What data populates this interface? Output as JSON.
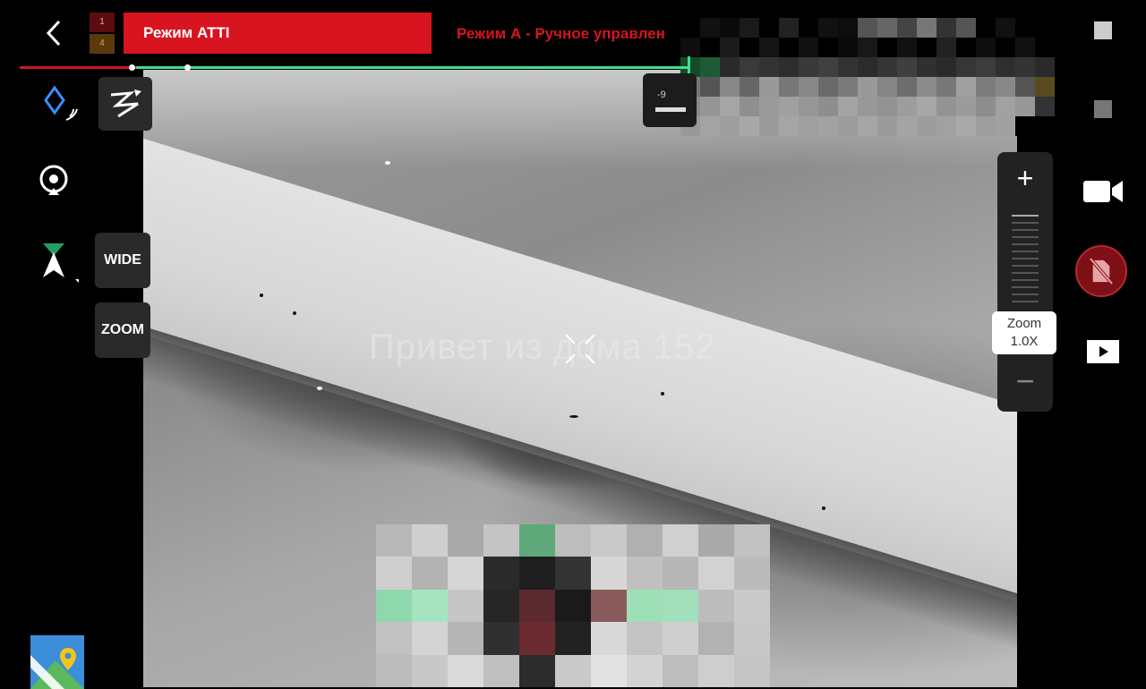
{
  "top_bar": {
    "back_icon": "chevron-left-icon",
    "battery_cells": [
      "1",
      "4"
    ],
    "mode_badge": "Режим ATTI",
    "mode_subtitle": "Режим А - Ручное управлен",
    "telemetry_value": "-9"
  },
  "left_panel": {
    "gps_icon": "diamond-signal-icon",
    "target_icon": "target-pin-icon",
    "compass_icon": "north-arrow-icon",
    "route_icon": "flight-route-icon",
    "wide_label": "WIDE",
    "zoom_label": "ZOOM",
    "map_icon": "map-pin-icon"
  },
  "camera_feed": {
    "watermark": "Привет из дома 152",
    "crosshair_icon": "crosshair-icon"
  },
  "zoom_panel": {
    "zoom_in_symbol": "+",
    "zoom_out_symbol": "−",
    "zoom_label": "Zoom",
    "zoom_value": "1.0X"
  },
  "right_panel": {
    "video_icon": "video-camera-icon",
    "record_icon": "no-sd-card-icon",
    "playback_icon": "playback-icon"
  },
  "colors": {
    "accent_red": "#d7141f",
    "accent_green": "#3de28a"
  }
}
